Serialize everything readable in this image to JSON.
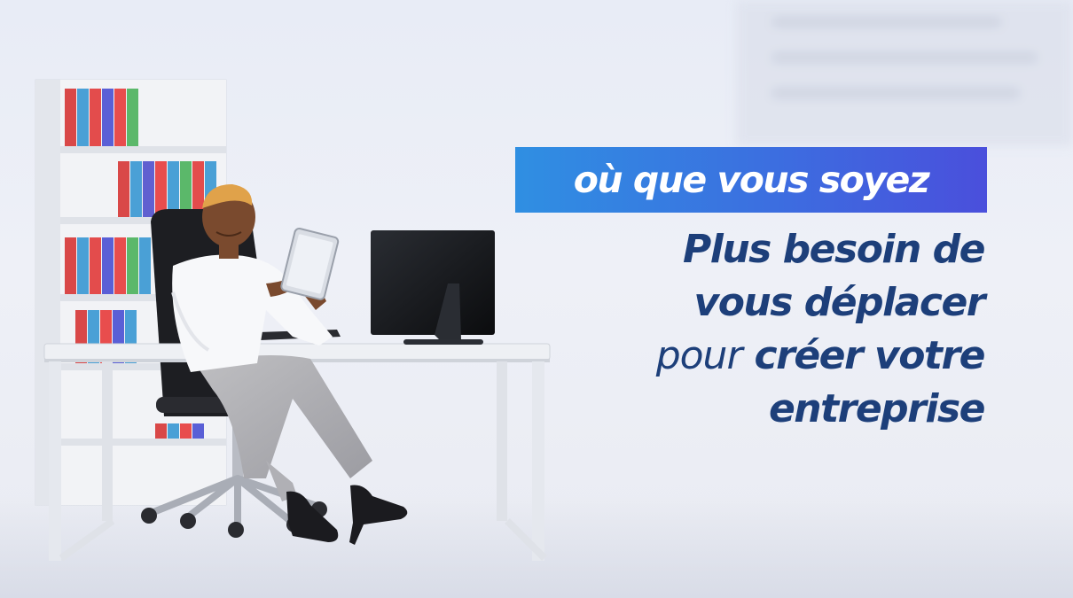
{
  "tagline": "où que vous soyez",
  "headline": {
    "line1": "Plus besoin de",
    "line2": "vous déplacer",
    "line3_light": "pour",
    "line3_bold": "créer votre",
    "line4": "entreprise"
  },
  "colors": {
    "tagline_start": "#2f8fe2",
    "tagline_end": "#4a4fdc",
    "headline_text": "#1d3f7a",
    "background": "#e8ecf6"
  }
}
